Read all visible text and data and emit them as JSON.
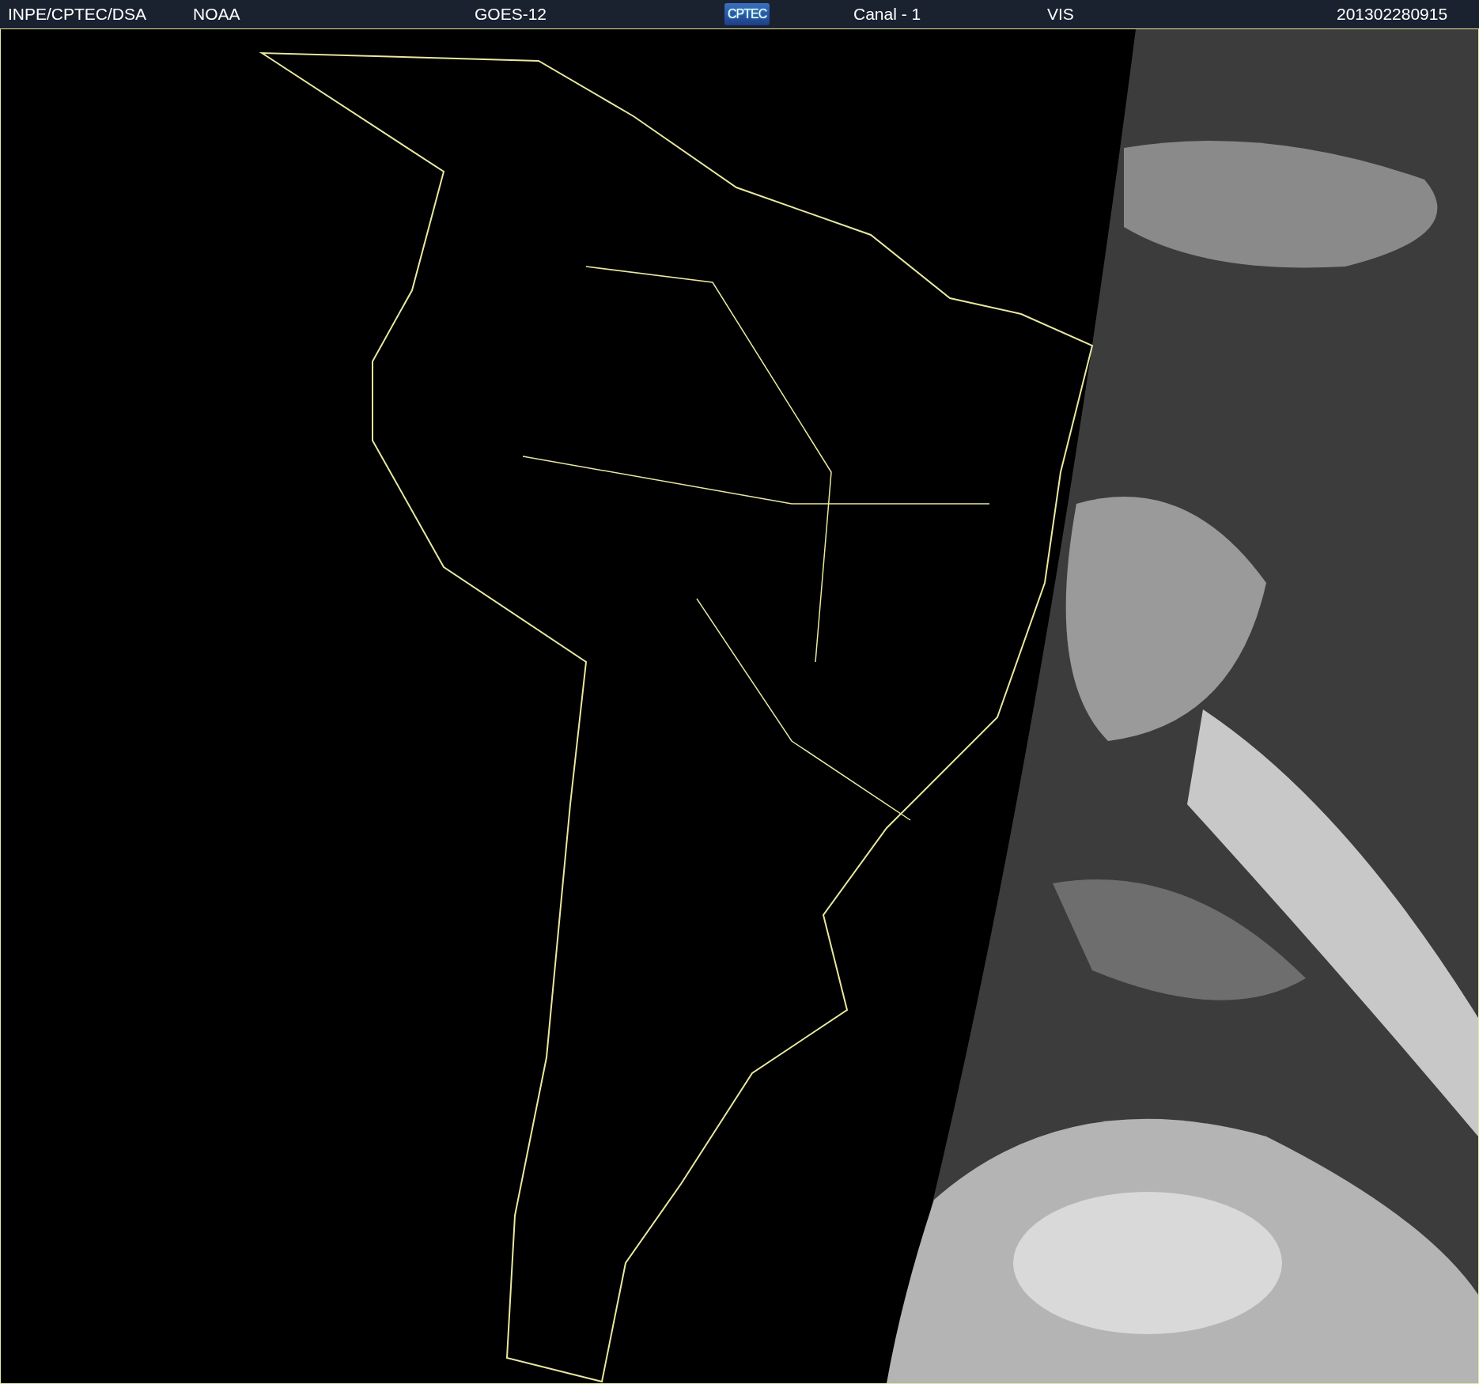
{
  "header": {
    "source": "INPE/CPTEC/DSA",
    "agency": "NOAA",
    "satellite": "GOES-12",
    "logo": "CPTEC",
    "channel": "Canal - 1",
    "band": "VIS",
    "timestamp": "201302280915"
  }
}
